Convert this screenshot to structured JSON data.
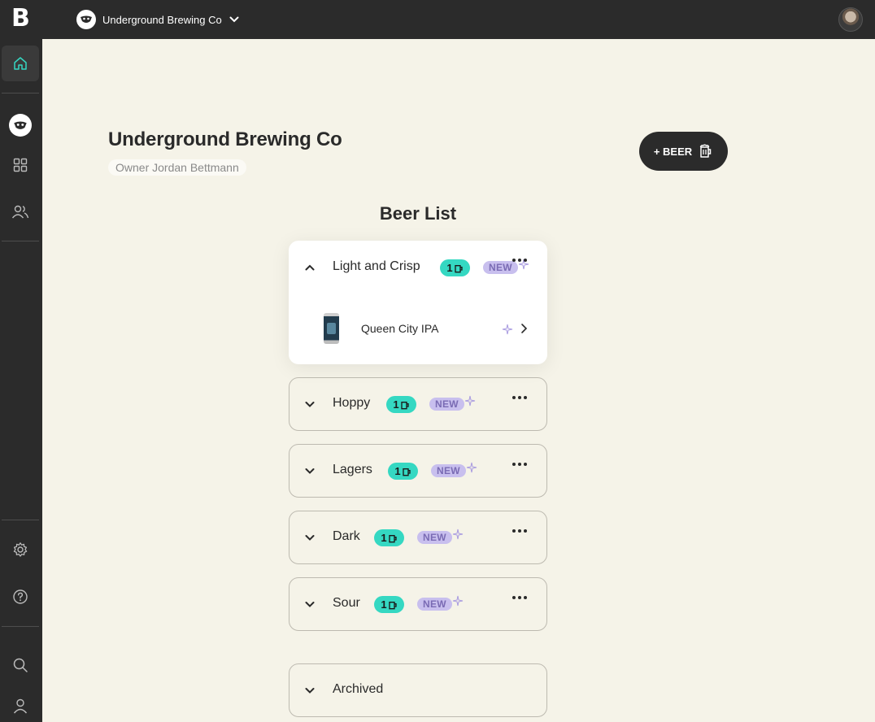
{
  "app": {
    "logo": "B",
    "brewery_name": "Underground Brewing Co"
  },
  "sidebar": {
    "items": [
      "home-icon",
      "brewery-avatar",
      "grid-icon",
      "users-icon",
      "settings-icon",
      "help-icon",
      "search-icon",
      "profile-icon"
    ],
    "active": "home-icon"
  },
  "header": {
    "title": "Underground Brewing Co",
    "owner": "Owner Jordan Bettmann",
    "add_beer_label": "+ BEER"
  },
  "beer_list": {
    "title": "Beer List",
    "categories": [
      {
        "name": "Light and Crisp",
        "count": "1",
        "badge": "NEW",
        "expanded": true,
        "beers": [
          {
            "name": "Queen City IPA"
          }
        ]
      },
      {
        "name": "Hoppy",
        "count": "1",
        "badge": "NEW",
        "expanded": false
      },
      {
        "name": "Lagers",
        "count": "1",
        "badge": "NEW",
        "expanded": false
      },
      {
        "name": "Dark",
        "count": "1",
        "badge": "NEW",
        "expanded": false
      },
      {
        "name": "Sour",
        "count": "1",
        "badge": "NEW",
        "expanded": false
      }
    ],
    "archived_label": "Archived"
  },
  "colors": {
    "background": "#f5f3e8",
    "chrome": "#2b2b2b",
    "accent_teal": "#35d8c2",
    "new_badge": "#c8bfee"
  }
}
